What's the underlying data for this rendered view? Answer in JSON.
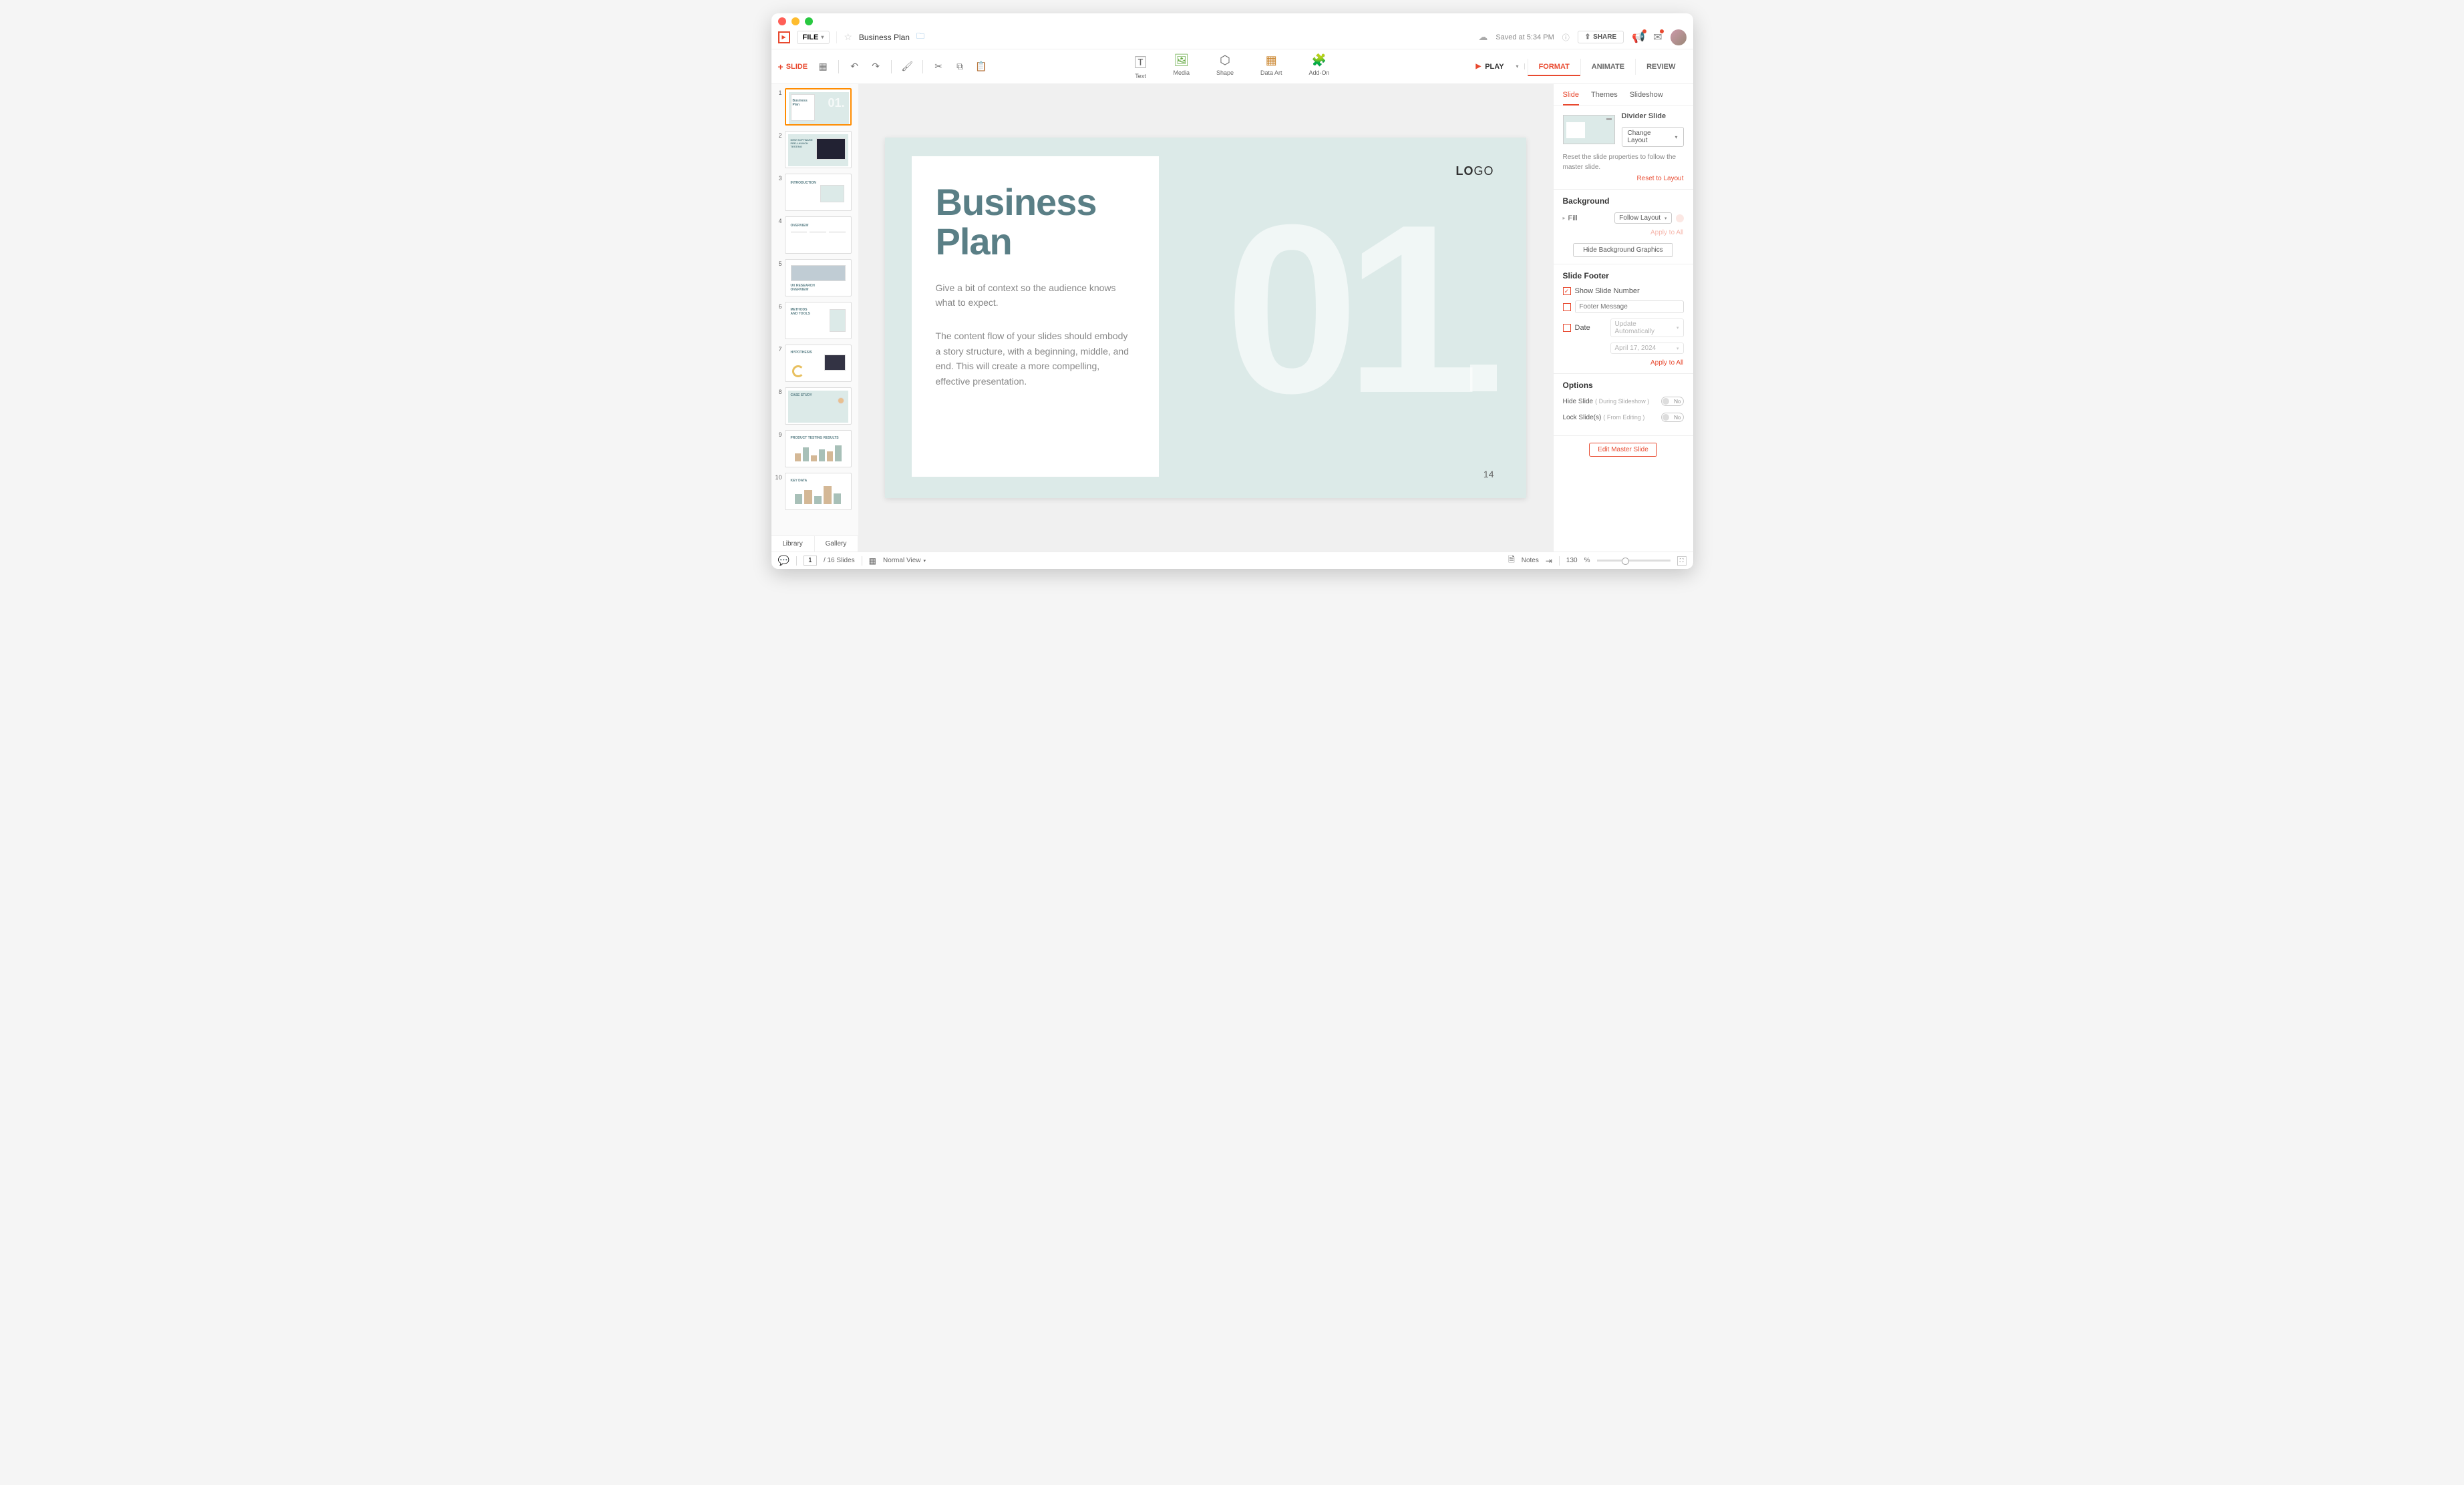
{
  "window": {
    "doc_title": "Business Plan"
  },
  "topbar": {
    "file_label": "FILE",
    "saved_text": "Saved at 5:34 PM",
    "share_label": "SHARE"
  },
  "toolbar": {
    "add_slide": "SLIDE",
    "center_tools": [
      {
        "label": "Text",
        "icon": "T"
      },
      {
        "label": "Media",
        "icon": "▣"
      },
      {
        "label": "Shape",
        "icon": "◯"
      },
      {
        "label": "Data Art",
        "icon": "▥"
      },
      {
        "label": "Add-On",
        "icon": "✚"
      }
    ],
    "play_label": "PLAY",
    "main_tabs": [
      "FORMAT",
      "ANIMATE",
      "REVIEW"
    ],
    "active_main_tab": "FORMAT"
  },
  "thumbnails": {
    "footer": {
      "library": "Library",
      "gallery": "Gallery"
    },
    "count": 10
  },
  "slide": {
    "title_line1": "Business",
    "title_line2": "Plan",
    "para1": "Give a bit of context so the audience knows what to expect.",
    "para2": "The content flow of your slides should embody a story structure, with a beginning, middle, and end. This will create a more compelling, effective presentation.",
    "big_number": "01",
    "logo_bold": "LO",
    "logo_light": "GO",
    "page_number": "14"
  },
  "right_panel": {
    "sub_tabs": [
      "Slide",
      "Themes",
      "Slideshow"
    ],
    "active_sub_tab": "Slide",
    "layout_name": "Divider Slide",
    "change_layout": "Change Layout",
    "reset_desc": "Reset the slide properties to follow the master slide.",
    "reset_link": "Reset to Layout",
    "background": {
      "heading": "Background",
      "fill_label": "Fill",
      "fill_value": "Follow Layout",
      "apply_all": "Apply to All",
      "hide_bg": "Hide Background Graphics"
    },
    "footer": {
      "heading": "Slide Footer",
      "show_num": "Show Slide Number",
      "footer_placeholder": "Footer Message",
      "date_label": "Date",
      "date_update": "Update Automatically",
      "date_value": "April 17, 2024",
      "apply_all": "Apply to All"
    },
    "options": {
      "heading": "Options",
      "hide_slide": "Hide Slide",
      "hide_slide_sub": "( During Slideshow )",
      "lock_slide": "Lock Slide(s)",
      "lock_slide_sub": "( From Editing )",
      "toggle_no": "No"
    },
    "edit_master": "Edit Master Slide"
  },
  "statusbar": {
    "current_page": "1",
    "total_pages": "/ 16 Slides",
    "view_mode": "Normal View",
    "notes": "Notes",
    "zoom": "130",
    "zoom_unit": "%"
  }
}
